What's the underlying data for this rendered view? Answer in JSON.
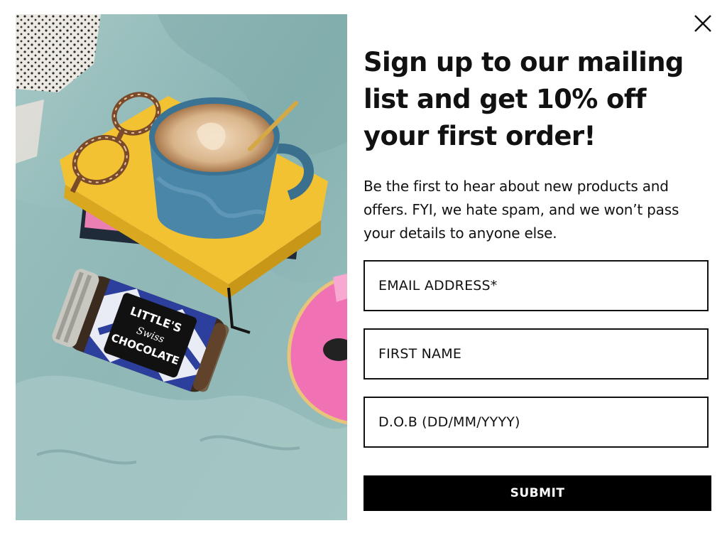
{
  "popup": {
    "headline": "Sign up to our mailing list and get 10% off your first order!",
    "description": "Be the first to hear about new products and offers. FYI, we hate spam, and we won’t pass your details to anyone else.",
    "close_icon": "close-icon"
  },
  "form": {
    "email_placeholder": "EMAIL ADDRESS*",
    "first_name_placeholder": "FIRST NAME",
    "dob_placeholder": "D.O.B (DD/MM/YYYY)",
    "submit_label": "SUBMIT"
  },
  "photo": {
    "jar_label_line1": "LITTLE'S",
    "jar_label_line2": "Swiss",
    "jar_label_line3": "CHOCOLATE"
  },
  "colors": {
    "text": "#111111",
    "button_bg": "#000000",
    "button_text": "#ffffff",
    "background": "#ffffff"
  }
}
